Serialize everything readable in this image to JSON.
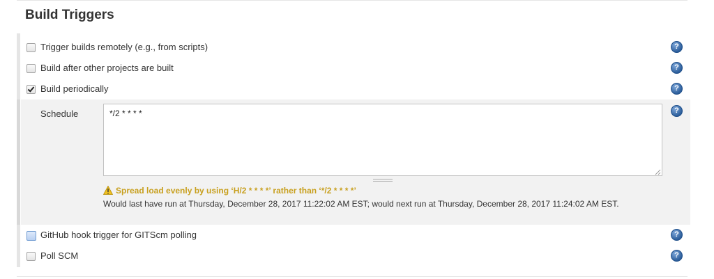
{
  "section": {
    "title": "Build Triggers"
  },
  "triggers": {
    "remote": {
      "label": "Trigger builds remotely (e.g., from scripts)",
      "checked": false
    },
    "after_other": {
      "label": "Build after other projects are built",
      "checked": false
    },
    "periodically": {
      "label": "Build periodically",
      "checked": true
    },
    "github_hook": {
      "label": "GitHub hook trigger for GITScm polling",
      "checked": false
    },
    "poll_scm": {
      "label": "Poll SCM",
      "checked": false
    }
  },
  "schedule": {
    "label": "Schedule",
    "value": "*/2 * * * *",
    "warning": "Spread load evenly by using ‘H/2 * * * *’ rather than ‘*/2 * * * *’",
    "run_info": "Would last have run at Thursday, December 28, 2017 11:22:02 AM EST; would next run at Thursday, December 28, 2017 11:24:02 AM EST."
  },
  "help": {
    "glyph": "?"
  },
  "colors": {
    "warning": "#c8a01f",
    "help_blue": "#2d5f9c",
    "schedule_bg": "#f2f2f2"
  }
}
